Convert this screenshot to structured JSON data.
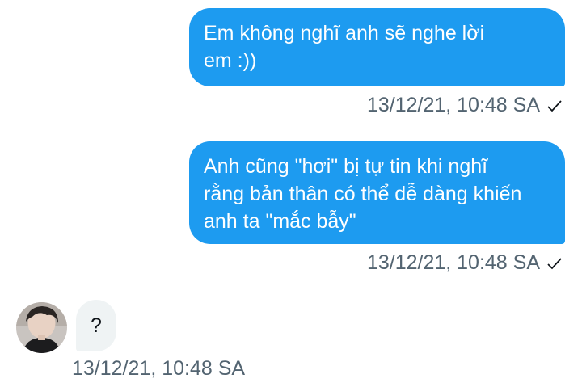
{
  "messages": [
    {
      "direction": "outgoing",
      "lines": [
        "Em không nghĩ anh sẽ nghe lời",
        "em :))"
      ],
      "timestamp": "13/12/21, 10:48 SA",
      "status_icon": "check-icon"
    },
    {
      "direction": "outgoing",
      "lines": [
        "Anh cũng \"hơi\" bị tự tin khi nghĩ",
        "rằng bản thân có thể dễ dàng khiến",
        "anh ta \"mắc bẫy\""
      ],
      "timestamp": "13/12/21, 10:48 SA",
      "status_icon": "check-icon"
    },
    {
      "direction": "incoming",
      "avatar_icon": "user-avatar",
      "text": "?",
      "timestamp": "13/12/21, 10:48 SA"
    }
  ],
  "colors": {
    "outgoing_bubble": "#1d9bf0",
    "incoming_bubble": "#eff3f4",
    "meta_text": "#536471"
  }
}
